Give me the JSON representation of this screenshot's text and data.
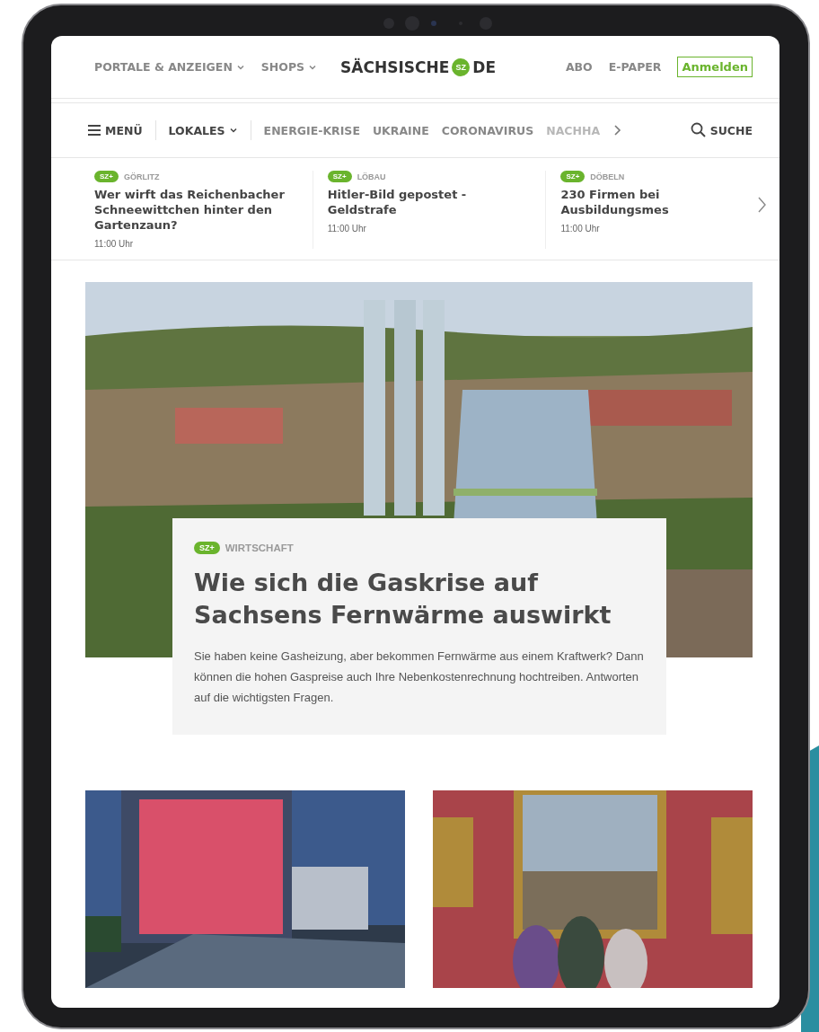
{
  "header": {
    "menus": [
      {
        "label": "PORTALE & ANZEIGEN"
      },
      {
        "label": "SHOPS"
      }
    ],
    "logo": {
      "left": "SÄCHSISCHE",
      "badge": "SZ",
      "right": "DE"
    },
    "links": [
      {
        "label": "ABO"
      },
      {
        "label": "E-PAPER"
      }
    ],
    "login": "Anmelden"
  },
  "nav": {
    "menu": "MENÜ",
    "lokales": "LOKALES",
    "topics": [
      {
        "label": "ENERGIE-KRISE"
      },
      {
        "label": "UKRAINE"
      },
      {
        "label": "CORONAVIRUS"
      },
      {
        "label": "NACHHA"
      }
    ],
    "search": "SUCHE"
  },
  "teasers": [
    {
      "badge": "SZ+",
      "category": "GÖRLITZ",
      "title": "Wer wirft das Reichenbacher Schneewittchen hinter den Gartenzaun?",
      "time": "11:00 Uhr"
    },
    {
      "badge": "SZ+",
      "category": "LÖBAU",
      "title": "Hitler-Bild gepostet - Geldstrafe",
      "time": "11:00 Uhr"
    },
    {
      "badge": "SZ+",
      "category": "DÖBELN",
      "title": "230 Firmen bei Ausbildungsmes",
      "time": "11:00 Uhr"
    }
  ],
  "hero": {
    "badge": "SZ+",
    "category": "WIRTSCHAFT",
    "title": "Wie sich die Gaskrise auf Sachsens Fernwärme auswirkt",
    "text": "Sie haben keine Gasheizung, aber bekommen Fernwärme aus einem Kraftwerk? Dann können die hohen Gaspreise auch Ihre Nebenkostenrechnung hochtreiben. Antworten auf die wichtigsten Fragen."
  },
  "articles": [
    {
      "kind": "building"
    },
    {
      "kind": "museum"
    }
  ]
}
